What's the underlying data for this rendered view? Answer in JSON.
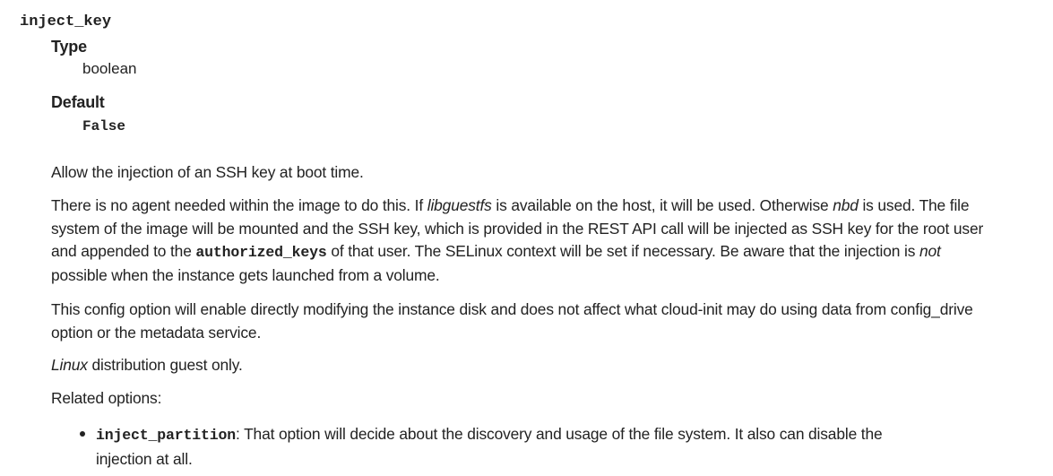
{
  "option": {
    "name": "inject_key",
    "type_label": "Type",
    "type_value": "boolean",
    "default_label": "Default",
    "default_value": "False"
  },
  "description": {
    "p1": "Allow the injection of an SSH key at boot time.",
    "p2": {
      "t1": "There is no agent needed within the image to do this. If ",
      "em1": "libguestfs",
      "t2": " is available on the host, it will be used. Otherwise ",
      "em2": "nbd",
      "t3": " is used. The file system of the image will be mounted and the SSH key, which is provided in the REST API call will be injected as SSH key for the root user and appended to the ",
      "code1": "authorized_keys",
      "t4": " of that user. The SELinux context will be set if necessary. Be aware that the injection is ",
      "em3": "not",
      "t5": " possible when the instance gets launched from a volume."
    },
    "p3": "This config option will enable directly modifying the instance disk and does not affect what cloud-init may do using data from config_drive option or the metadata service.",
    "p4": {
      "em": "Linux",
      "t": " distribution guest only."
    },
    "p5": "Related options:"
  },
  "related_options": [
    {
      "code": "inject_partition",
      "text": ": That option will decide about the discovery and usage of the file system. It also can disable the injection at all."
    }
  ]
}
